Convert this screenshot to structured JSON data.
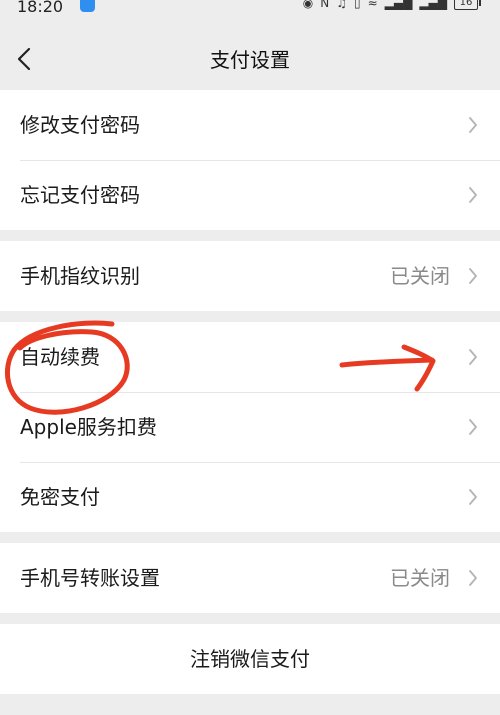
{
  "status_bar": {
    "time": "18:20",
    "battery": "16"
  },
  "nav": {
    "title": "支付设置"
  },
  "groups": [
    {
      "items": [
        {
          "label": "修改支付密码",
          "value": ""
        },
        {
          "label": "忘记支付密码",
          "value": ""
        }
      ]
    },
    {
      "items": [
        {
          "label": "手机指纹识别",
          "value": "已关闭"
        }
      ]
    },
    {
      "items": [
        {
          "label": "自动续费",
          "value": ""
        },
        {
          "label": "Apple服务扣费",
          "value": ""
        },
        {
          "label": "免密支付",
          "value": ""
        }
      ]
    },
    {
      "items": [
        {
          "label": "手机号转账设置",
          "value": "已关闭"
        }
      ]
    },
    {
      "items": [
        {
          "label": "注销微信支付",
          "value": ""
        }
      ]
    }
  ],
  "annotation_color": "#e63b22",
  "icons": [
    "back-icon",
    "chevron-right-icon",
    "wifi-icon",
    "signal-icon",
    "battery-icon"
  ]
}
